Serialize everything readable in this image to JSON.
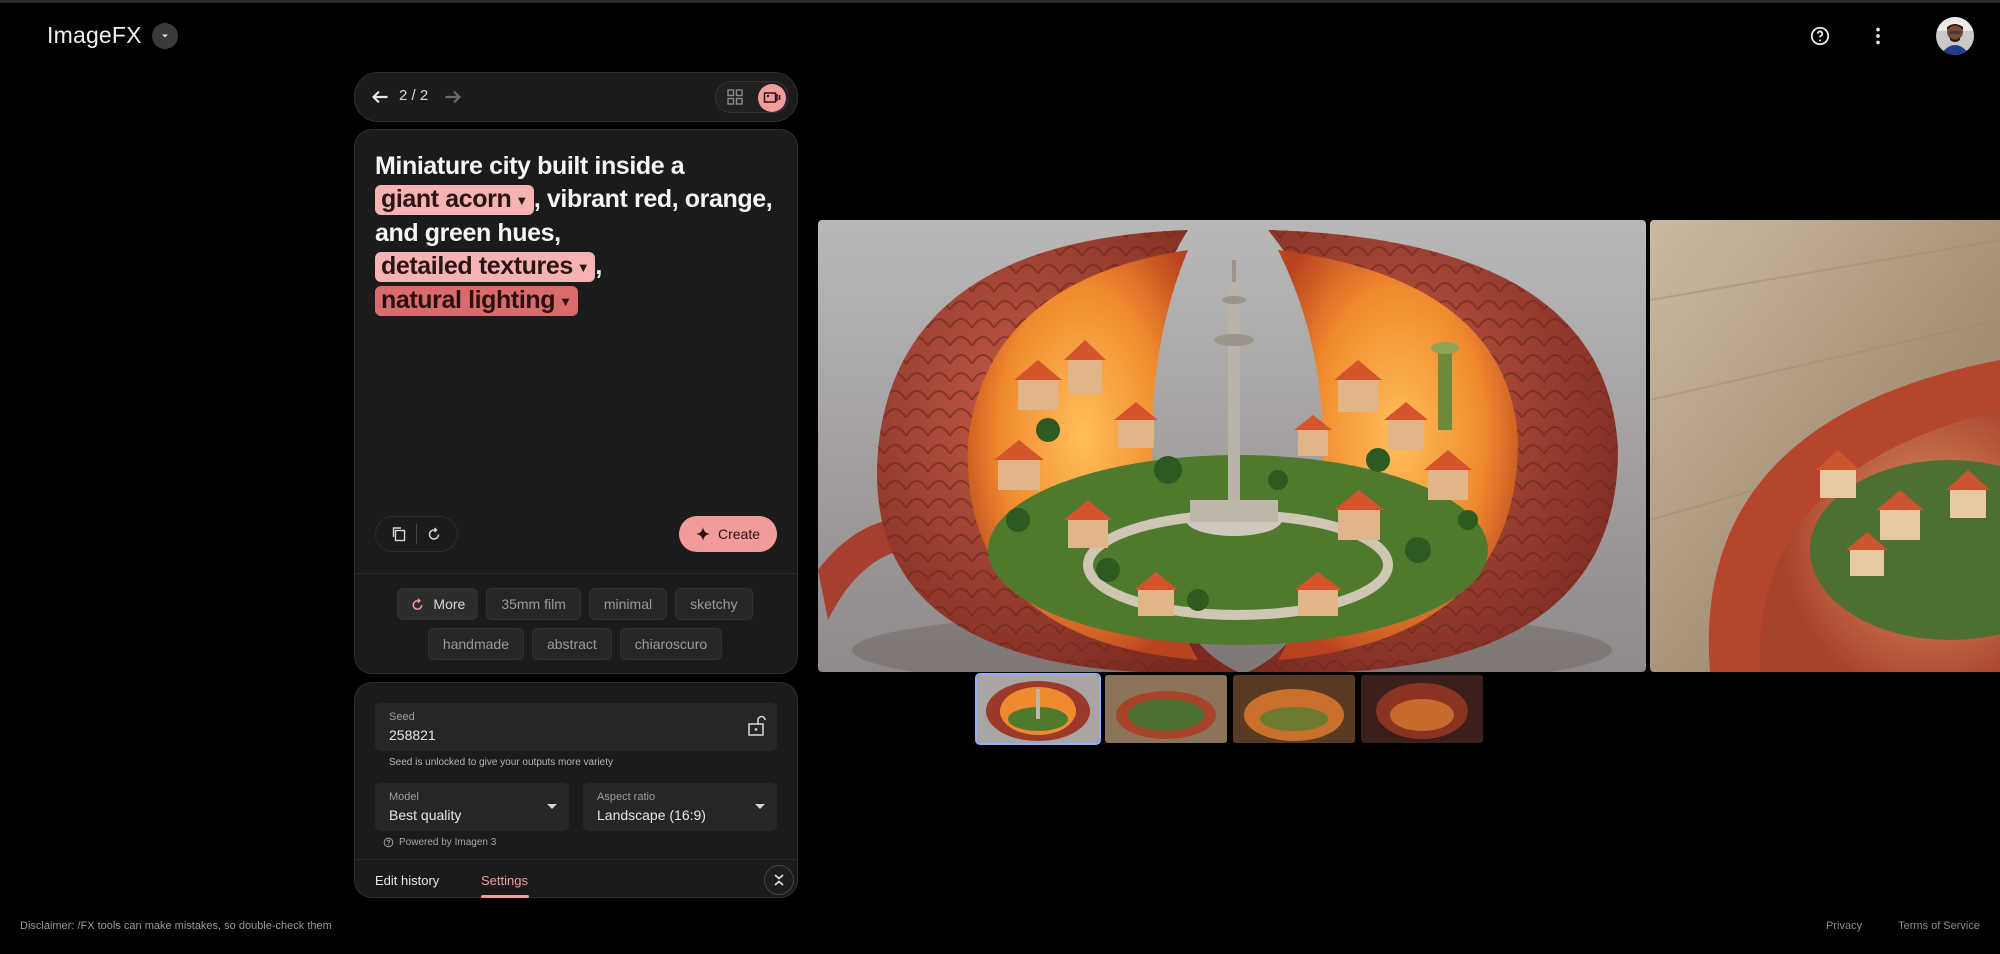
{
  "app": {
    "title": "ImageFX"
  },
  "header": {
    "help_icon": "help-circle-icon",
    "menu_icon": "more-vert-icon"
  },
  "navigation": {
    "counter": "2 / 2"
  },
  "prompt": {
    "text_1": "Miniature city built inside a",
    "chip_1": "giant acorn",
    "text_2": ", vibrant red, orange, and green hues,",
    "chip_2": "detailed textures",
    "text_3": ",",
    "chip_3": "natural lighting",
    "create_label": "Create"
  },
  "suggestions": {
    "more_label": "More",
    "items": [
      "35mm film",
      "minimal",
      "sketchy",
      "handmade",
      "abstract",
      "chiaroscuro"
    ]
  },
  "settings": {
    "seed_label": "Seed",
    "seed_value": "258821",
    "seed_note": "Seed is unlocked to give your outputs more variety",
    "model_label": "Model",
    "model_value": "Best quality",
    "aspect_label": "Aspect ratio",
    "aspect_value": "Landscape (16:9)",
    "powered_by": "Powered by Imagen 3"
  },
  "tabs": {
    "edit_history": "Edit history",
    "settings": "Settings",
    "active": "Settings"
  },
  "gallery": {
    "thumbnail_count": 4,
    "selected_index": 0
  },
  "footer": {
    "disclaimer": "Disclaimer: /FX tools can make mistakes, so double-check them",
    "privacy": "Privacy",
    "terms": "Terms of Service"
  },
  "colors": {
    "accent": "#f29b9b",
    "chip_light": "#f5b3b3",
    "chip_dark": "#d96b6b",
    "panel": "#1b1b1c"
  }
}
